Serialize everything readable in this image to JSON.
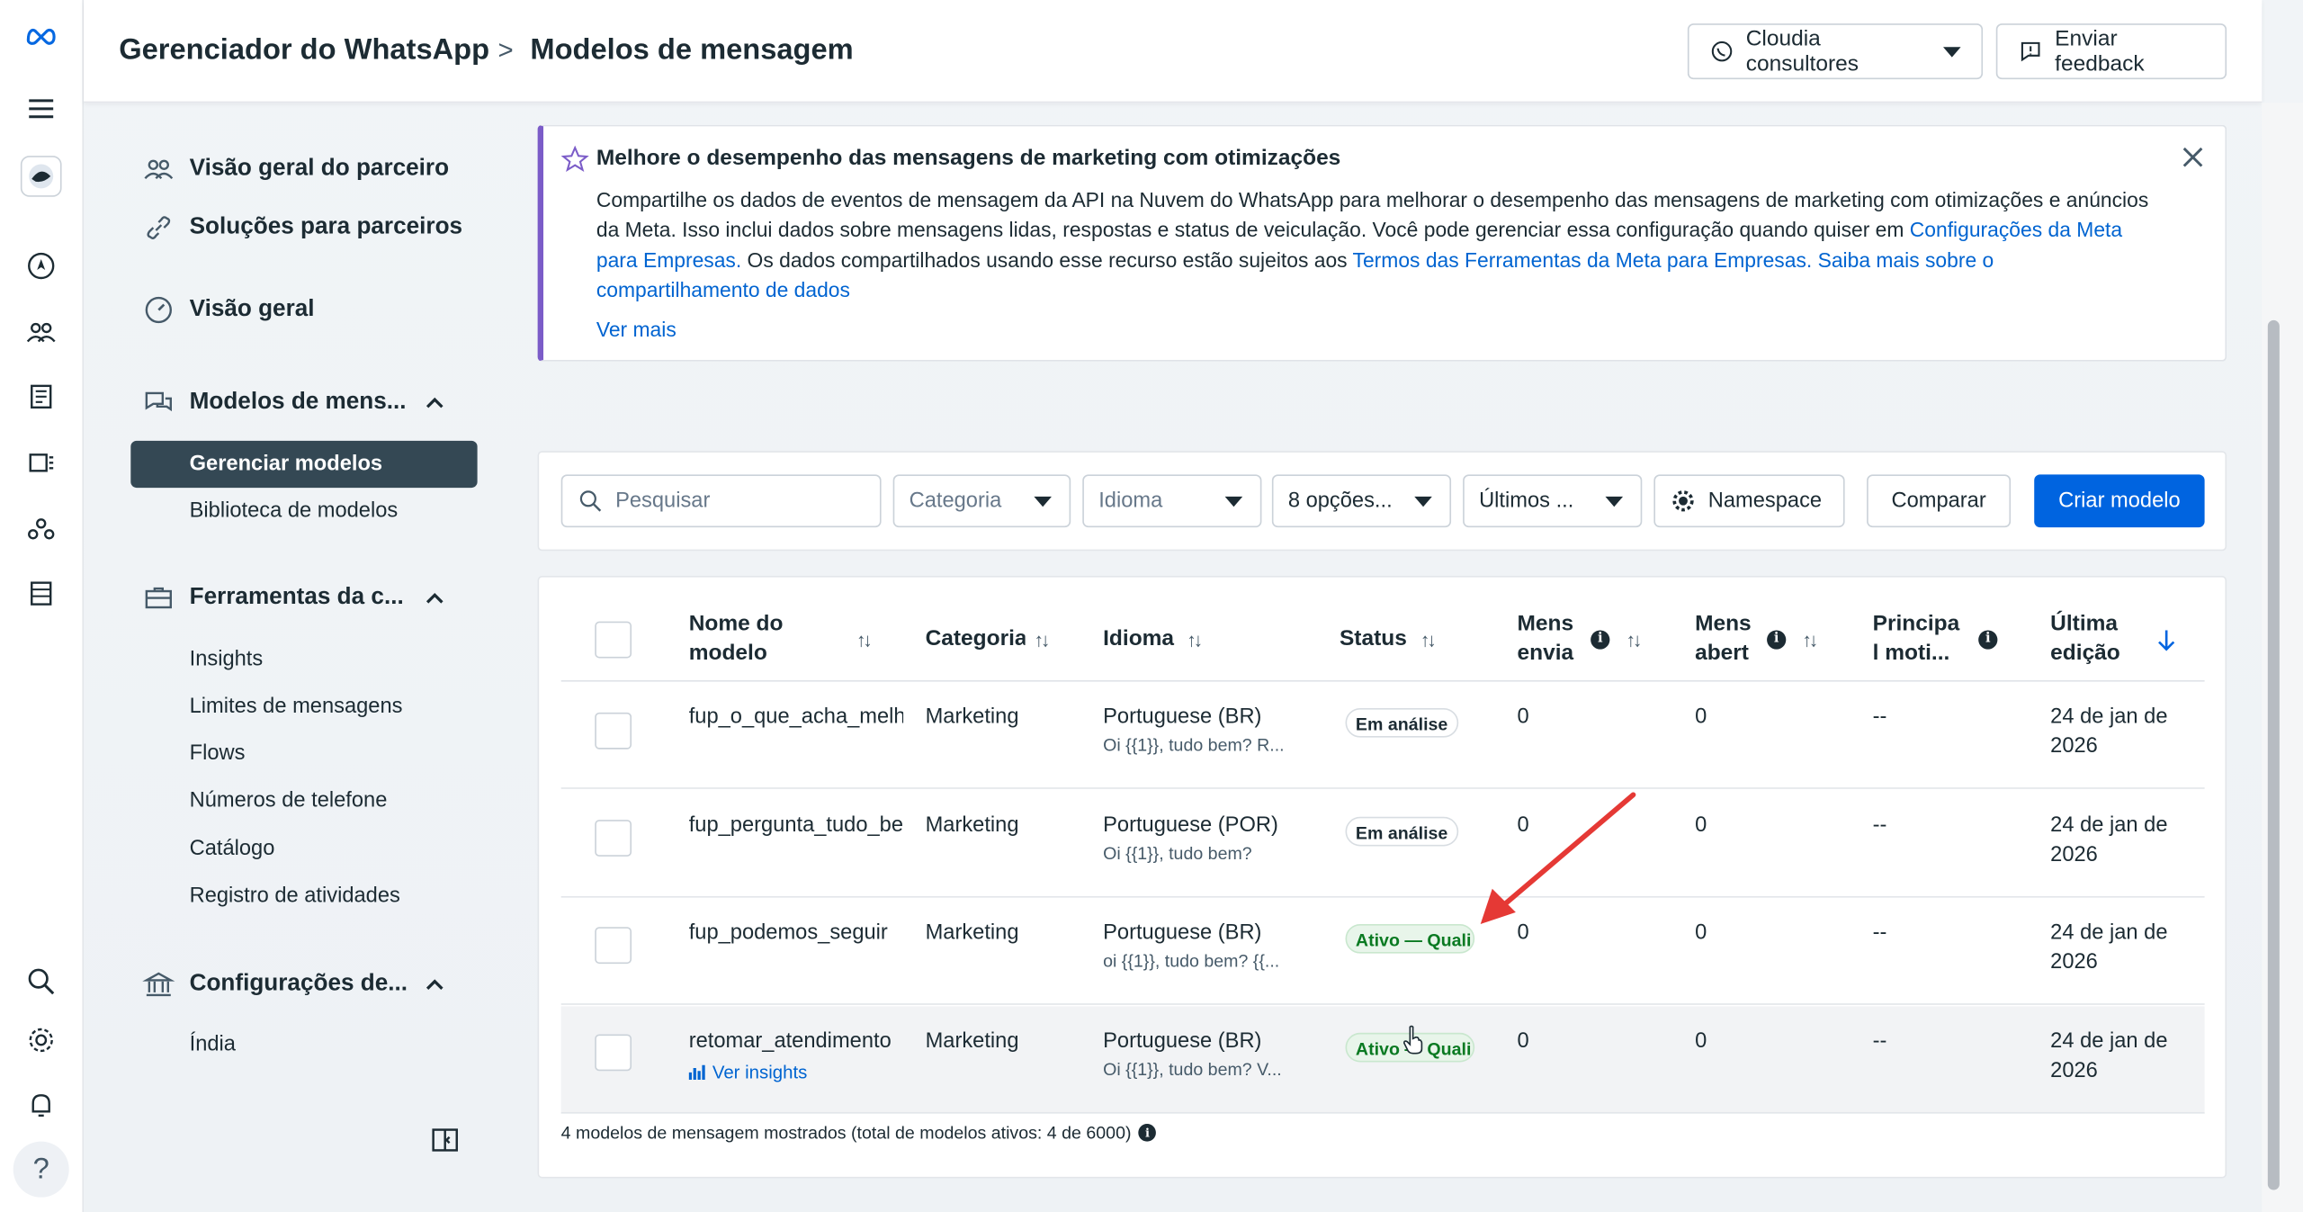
{
  "header": {
    "app_title": "Gerenciador do WhatsApp",
    "separator": ">",
    "page_title": "Modelos de mensagem",
    "account_button": "Cloudia consultores",
    "feedback_button": "Enviar feedback"
  },
  "sidebar": {
    "items": [
      {
        "label": "Visão geral do parceiro",
        "icon": "people-icon"
      },
      {
        "label": "Soluções para parceiros",
        "icon": "link-icon"
      },
      {
        "label": "Visão geral",
        "icon": "speedometer-icon"
      }
    ],
    "templates_section": {
      "label": "Modelos de mens...",
      "active_item": "Gerenciar modelos",
      "library_item": "Biblioteca de modelos"
    },
    "tools_section": {
      "label": "Ferramentas da c...",
      "items": [
        "Insights",
        "Limites de mensagens",
        "Flows",
        "Números de telefone",
        "Catálogo",
        "Registro de atividades"
      ]
    },
    "settings_section": {
      "label": "Configurações de...",
      "items": [
        "Índia"
      ]
    }
  },
  "banner": {
    "title": "Melhore o desempenho das mensagens de marketing com otimizações",
    "body_1": "Compartilhe os dados de eventos de mensagem da API na Nuvem do WhatsApp para melhorar o desempenho das mensagens de marketing com otimizações e anúncios da Meta. Isso inclui dados sobre mensagens lidas, respostas e status de veiculação. Você pode gerenciar essa configuração quando quiser em ",
    "link_1": "Configurações da Meta para Empresas.",
    "body_2": " Os dados compartilhados usando esse recurso estão sujeitos aos ",
    "link_2": "Termos das Ferramentas da Meta para Empresas.",
    "link_3": " Saiba mais sobre o compartilhamento de dados",
    "more": "Ver mais"
  },
  "toolbar": {
    "search_placeholder": "Pesquisar",
    "category": "Categoria",
    "language": "Idioma",
    "status_filter": "8 opções...",
    "date_filter": "Últimos ...",
    "namespace_button": "Namespace",
    "compare_button": "Comparar",
    "create_button": "Criar modelo"
  },
  "table": {
    "columns": {
      "name": "Nome do modelo",
      "category": "Categoria",
      "language": "Idioma",
      "status": "Status",
      "sent": "Mens envia",
      "opened": "Mens abert",
      "reason": "Principa l moti...",
      "edited": "Última edição"
    },
    "rows": [
      {
        "name": "fup_o_que_acha_melh",
        "category": "Marketing",
        "language": "Portuguese (BR)",
        "preview": "Oi {{1}}, tudo bem? R...",
        "status": "Em análise",
        "status_type": "review",
        "sent": "0",
        "opened": "0",
        "reason": "--",
        "edited_1": "24 de jan de",
        "edited_2": "2026"
      },
      {
        "name": "fup_pergunta_tudo_be",
        "category": "Marketing",
        "language": "Portuguese (POR)",
        "preview": "Oi {{1}}, tudo bem?",
        "status": "Em análise",
        "status_type": "review",
        "sent": "0",
        "opened": "0",
        "reason": "--",
        "edited_1": "24 de jan de",
        "edited_2": "2026"
      },
      {
        "name": "fup_podemos_seguir",
        "category": "Marketing",
        "language": "Portuguese (BR)",
        "preview": "oi {{1}}, tudo bem? {{...",
        "status": "Ativo — Quali",
        "status_type": "active",
        "sent": "0",
        "opened": "0",
        "reason": "--",
        "edited_1": "24 de jan de",
        "edited_2": "2026"
      },
      {
        "name": "retomar_atendimento",
        "insights": "Ver insights",
        "category": "Marketing",
        "language": "Portuguese (BR)",
        "preview": "Oi {{1}}, tudo bem? V...",
        "status": "Ativo — Quali",
        "status_type": "active",
        "sent": "0",
        "opened": "0",
        "reason": "--",
        "edited_1": "24 de jan de",
        "edited_2": "2026"
      }
    ],
    "footer": "4 modelos de mensagem mostrados (total de modelos ativos: 4 de 6000)"
  },
  "colors": {
    "primary": "#0064e0",
    "sidebar_active": "#344854",
    "banner_accent": "#7b5cc8",
    "active_badge": "#0a7a22",
    "annotation_arrow": "#e53935"
  }
}
